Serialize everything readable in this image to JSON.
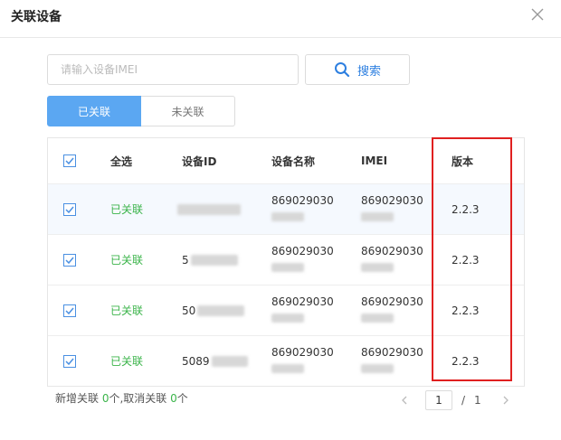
{
  "dialog": {
    "title": "关联设备"
  },
  "search": {
    "placeholder": "请输入设备IMEI",
    "value": "",
    "button_label": "搜索"
  },
  "tabs": [
    {
      "label": "已关联",
      "active": true
    },
    {
      "label": "未关联",
      "active": false
    }
  ],
  "table": {
    "headers": {
      "select_all": "全选",
      "device_id": "设备ID",
      "device_name": "设备名称",
      "imei": "IMEI",
      "version": "版本"
    },
    "rows": [
      {
        "checked": true,
        "status": "已关联",
        "device_id": "",
        "name_line1": "869029030",
        "imei_line1": "869029030",
        "version": "2.2.3"
      },
      {
        "checked": true,
        "status": "已关联",
        "device_id": "5",
        "name_line1": "869029030",
        "imei_line1": "869029030",
        "version": "2.2.3"
      },
      {
        "checked": true,
        "status": "已关联",
        "device_id": "50",
        "name_line1": "869029030",
        "imei_line1": "869029030",
        "version": "2.2.3"
      },
      {
        "checked": true,
        "status": "已关联",
        "device_id": "5089",
        "name_line1": "869029030",
        "imei_line1": "869029030",
        "version": "2.2.3"
      }
    ]
  },
  "footer": {
    "added_prefix": "新增关联 ",
    "added_count": "0",
    "added_suffix": "个,取消关联 ",
    "removed_count": "0",
    "removed_suffix": "个"
  },
  "pagination": {
    "current": "1",
    "separator": "/",
    "total": "1"
  },
  "colors": {
    "accent": "#5ba7f2",
    "status_green": "#3bb44a",
    "highlight": "#e02020"
  }
}
